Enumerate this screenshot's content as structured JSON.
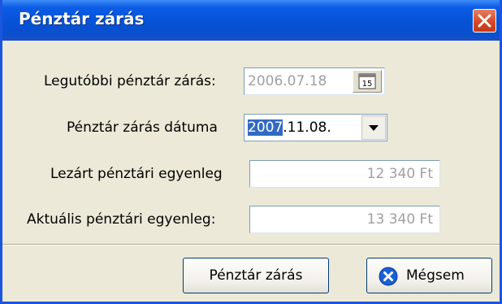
{
  "window": {
    "title": "Pénztár zárás"
  },
  "form": {
    "last_closing_label": "Legutóbbi pénztár zárás:",
    "last_closing_value": "2006.07.18",
    "calendar_icon_day": "15",
    "closing_date_label": "Pénztár zárás dátuma",
    "closing_date_selected_part": "2007",
    "closing_date_rest": ".11.08.",
    "closed_balance_label": "Lezárt pénztári egyenleg",
    "closed_balance_value": "12 340 Ft",
    "current_balance_label": "Aktuális pénztári egyenleg:",
    "current_balance_value": "13 340 Ft"
  },
  "buttons": {
    "close_cash_label": "Pénztár zárás",
    "cancel_label": "Mégsem"
  },
  "colors": {
    "titlebar": "#0652d7",
    "dialog_bg": "#ece9d8",
    "close_button": "#d54522",
    "selection": "#316ac5",
    "cancel_icon": "#1a5fd4"
  }
}
